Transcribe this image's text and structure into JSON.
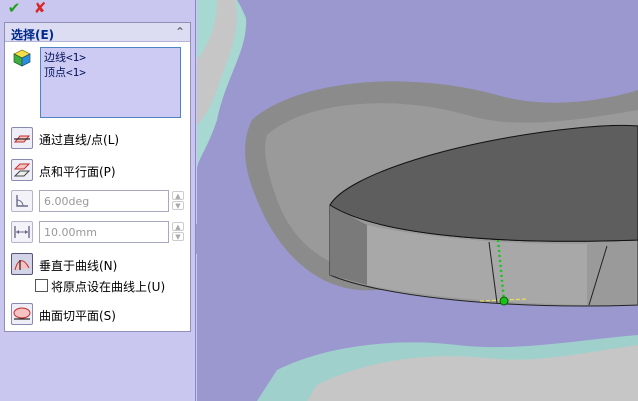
{
  "toolbar": {
    "ok_icon": "checkmark-icon",
    "cancel_icon": "close-icon",
    "ok_glyph": "✔",
    "cancel_glyph": "✘"
  },
  "selection": {
    "title": "选择(E)",
    "collapse_glyph": "⌃",
    "items": [
      "边线<1>",
      "顶点<1>"
    ]
  },
  "options": {
    "through_line_point": "通过直线/点(L)",
    "point_parallel_plane": "点和平行面(P)",
    "angle_value": "6.00deg",
    "distance_value": "10.00mm",
    "normal_to_curve": "垂直于曲线(N)",
    "origin_on_curve": "将原点设在曲线上(U)",
    "surface_tangent": "曲面切平面(S)"
  },
  "colors": {
    "panel_bg": "#c9c6f0",
    "viewport_bg": "#9a98cf",
    "accent_blue": "#4c84c4",
    "ok_green": "#21a121",
    "cancel_red": "#d92626",
    "preview_green": "#1ac11a"
  }
}
